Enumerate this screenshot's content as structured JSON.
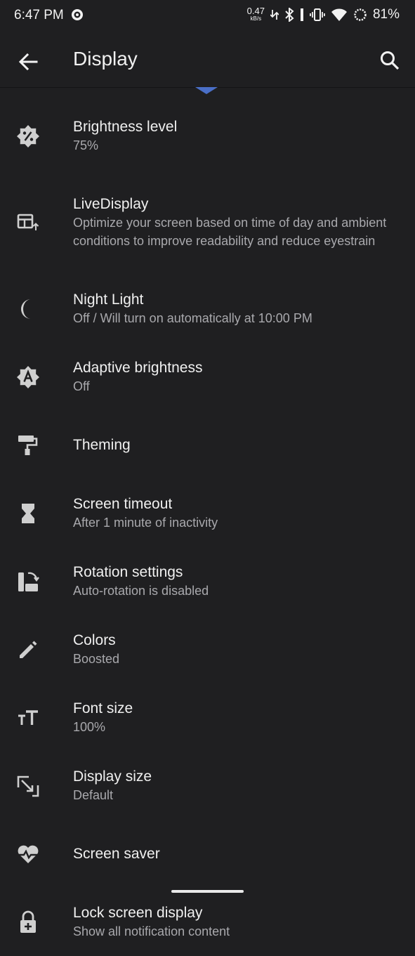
{
  "status_bar": {
    "time": "6:47 PM",
    "speed_value": "0.47",
    "speed_unit": "kB/s",
    "battery": "81%"
  },
  "app_bar": {
    "title": "Display"
  },
  "items": [
    {
      "title": "Brightness level",
      "summary": "75%"
    },
    {
      "title": "LiveDisplay",
      "summary": "Optimize your screen based on time of day and ambient conditions to improve readability and reduce eyestrain"
    },
    {
      "title": "Night Light",
      "summary": "Off / Will turn on automatically at 10:00 PM"
    },
    {
      "title": "Adaptive brightness",
      "summary": "Off"
    },
    {
      "title": "Theming",
      "summary": ""
    },
    {
      "title": "Screen timeout",
      "summary": "After 1 minute of inactivity"
    },
    {
      "title": "Rotation settings",
      "summary": "Auto-rotation is disabled"
    },
    {
      "title": "Colors",
      "summary": "Boosted"
    },
    {
      "title": "Font size",
      "summary": "100%"
    },
    {
      "title": "Display size",
      "summary": "Default"
    },
    {
      "title": "Screen saver",
      "summary": ""
    },
    {
      "title": "Lock screen display",
      "summary": "Show all notification content"
    }
  ],
  "icons": [
    "brightness-icon",
    "livedisplay-icon",
    "moon-icon",
    "adaptive-brightness-icon",
    "paint-roller-icon",
    "hourglass-icon",
    "rotation-icon",
    "pencil-icon",
    "font-size-icon",
    "display-size-icon",
    "screen-saver-icon",
    "lock-icon"
  ],
  "colors": {
    "background": "#1f1f21",
    "accent": "#4a6fc7",
    "primary_text": "#f0f0f0",
    "secondary_text": "#a9a9ad"
  }
}
